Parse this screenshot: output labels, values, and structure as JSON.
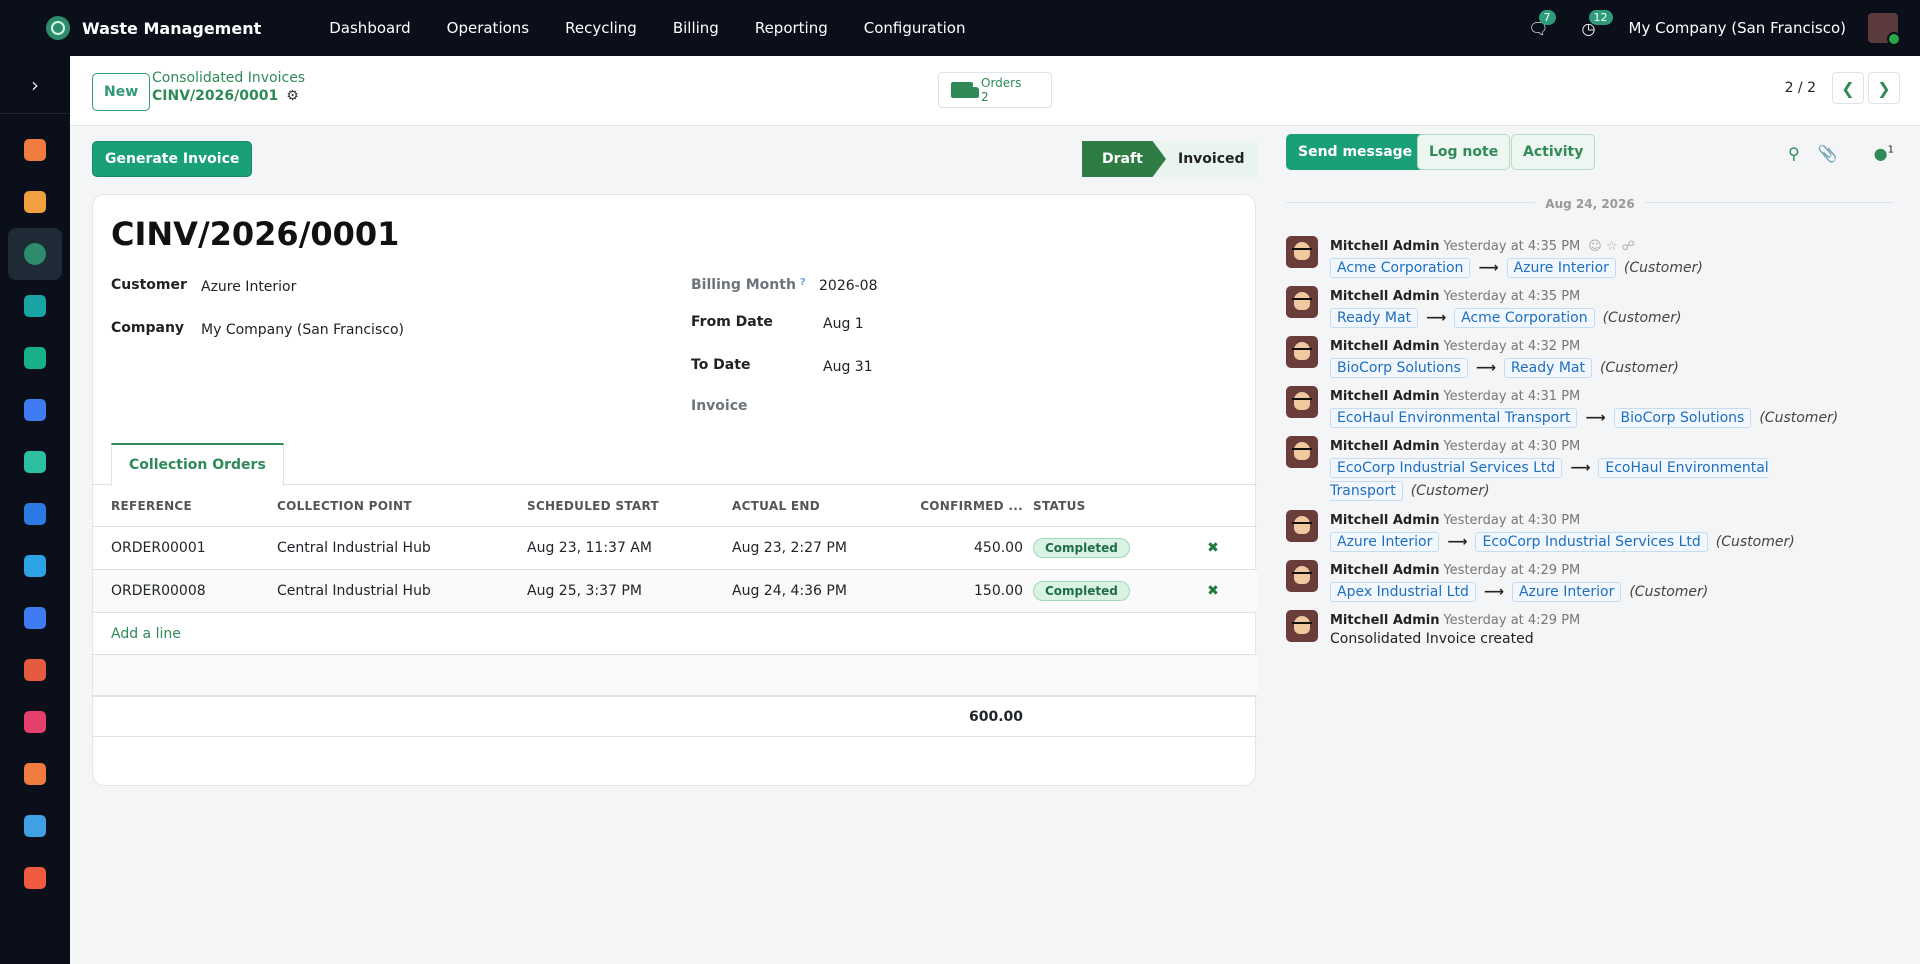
{
  "navbar": {
    "brand": "Waste Management",
    "menu": [
      "Dashboard",
      "Operations",
      "Recycling",
      "Billing",
      "Reporting",
      "Configuration"
    ],
    "messages_count": "7",
    "activities_count": "12",
    "company": "My Company (San Francisco)"
  },
  "control": {
    "new_label": "New",
    "breadcrumb_parent": "Consolidated Invoices",
    "breadcrumb_current": "CINV/2026/0001",
    "smart_orders_label": "Orders",
    "smart_orders_count": "2",
    "pager": "2 / 2"
  },
  "actions": {
    "generate": "Generate Invoice",
    "status_draft": "Draft",
    "status_invoiced": "Invoiced"
  },
  "form": {
    "title": "CINV/2026/0001",
    "customer_label": "Customer",
    "customer_value": "Azure Interior",
    "company_label": "Company",
    "company_value": "My Company (San Francisco)",
    "billing_month_label": "Billing Month",
    "billing_month_help": "?",
    "billing_month_value": "2026-08",
    "from_date_label": "From Date",
    "from_date_value": "Aug 1",
    "to_date_label": "To Date",
    "to_date_value": "Aug 31",
    "invoice_label": "Invoice"
  },
  "tab": {
    "label": "Collection Orders"
  },
  "table": {
    "headers": [
      "REFERENCE",
      "COLLECTION POINT",
      "SCHEDULED START",
      "ACTUAL END",
      "CONFIRMED ...",
      "STATUS"
    ],
    "rows": [
      {
        "reference": "ORDER00001",
        "point": "Central Industrial Hub",
        "start": "Aug 23, 11:37 AM",
        "end": "Aug 23, 2:27 PM",
        "qty": "450.00",
        "status": "Completed"
      },
      {
        "reference": "ORDER00008",
        "point": "Central Industrial Hub",
        "start": "Aug 25, 3:37 PM",
        "end": "Aug 24, 4:36 PM",
        "qty": "150.00",
        "status": "Completed"
      }
    ],
    "add_line": "Add a line",
    "total": "600.00"
  },
  "chatter": {
    "send_message": "Send message",
    "log_note": "Log note",
    "activity": "Activity",
    "followers_count": "1",
    "date_separator": "Aug 24, 2026",
    "messages": [
      {
        "author": "Mitchell Admin",
        "time": "Yesterday at 4:35 PM",
        "old": "Acme Corporation",
        "new": "Azure Interior",
        "field": "(Customer)"
      },
      {
        "author": "Mitchell Admin",
        "time": "Yesterday at 4:35 PM",
        "old": "Ready Mat",
        "new": "Acme Corporation",
        "field": "(Customer)"
      },
      {
        "author": "Mitchell Admin",
        "time": "Yesterday at 4:32 PM",
        "old": "BioCorp Solutions",
        "new": "Ready Mat",
        "field": "(Customer)"
      },
      {
        "author": "Mitchell Admin",
        "time": "Yesterday at 4:31 PM",
        "old": "EcoHaul Environmental Transport",
        "new": "BioCorp Solutions",
        "field": "(Customer)"
      },
      {
        "author": "Mitchell Admin",
        "time": "Yesterday at 4:30 PM",
        "old": "EcoCorp Industrial Services Ltd",
        "new": "EcoHaul Environmental Transport",
        "field": "(Customer)"
      },
      {
        "author": "Mitchell Admin",
        "time": "Yesterday at 4:30 PM",
        "old": "Azure Interior",
        "new": "EcoCorp Industrial Services Ltd",
        "field": "(Customer)"
      },
      {
        "author": "Mitchell Admin",
        "time": "Yesterday at 4:29 PM",
        "old": "Apex Industrial Ltd",
        "new": "Azure Interior",
        "field": "(Customer)"
      },
      {
        "author": "Mitchell Admin",
        "time": "Yesterday at 4:29 PM",
        "text": "Consolidated Invoice created"
      }
    ]
  },
  "sidebar_apps": [
    {
      "icon": "discuss-app-icon",
      "color": "#f07b3f"
    },
    {
      "icon": "calendar-app-icon",
      "color": "#f0a03f"
    },
    {
      "icon": "waste-management-app-icon",
      "color": "#2c8c6b"
    },
    {
      "icon": "contacts-app-icon",
      "color": "#1aa3a3"
    },
    {
      "icon": "crm-app-icon",
      "color": "#18b08a"
    },
    {
      "icon": "dashboards-app-icon",
      "color": "#3f7bf0"
    },
    {
      "icon": "recycling-app-icon",
      "color": "#2cbfa0"
    },
    {
      "icon": "sales-app-icon",
      "color": "#2c7be5"
    },
    {
      "icon": "website-app-icon",
      "color": "#2ba3e5"
    },
    {
      "icon": "project-app-icon",
      "color": "#3f7bf0"
    },
    {
      "icon": "inventory-app-icon",
      "color": "#e55a3f"
    },
    {
      "icon": "fleet-app-icon",
      "color": "#e53f6b"
    },
    {
      "icon": "marketing-app-icon",
      "color": "#f07b3f"
    },
    {
      "icon": "reporting-app-icon",
      "color": "#3fa0e5"
    },
    {
      "icon": "apps-app-icon",
      "color": "#f05a3f"
    }
  ]
}
